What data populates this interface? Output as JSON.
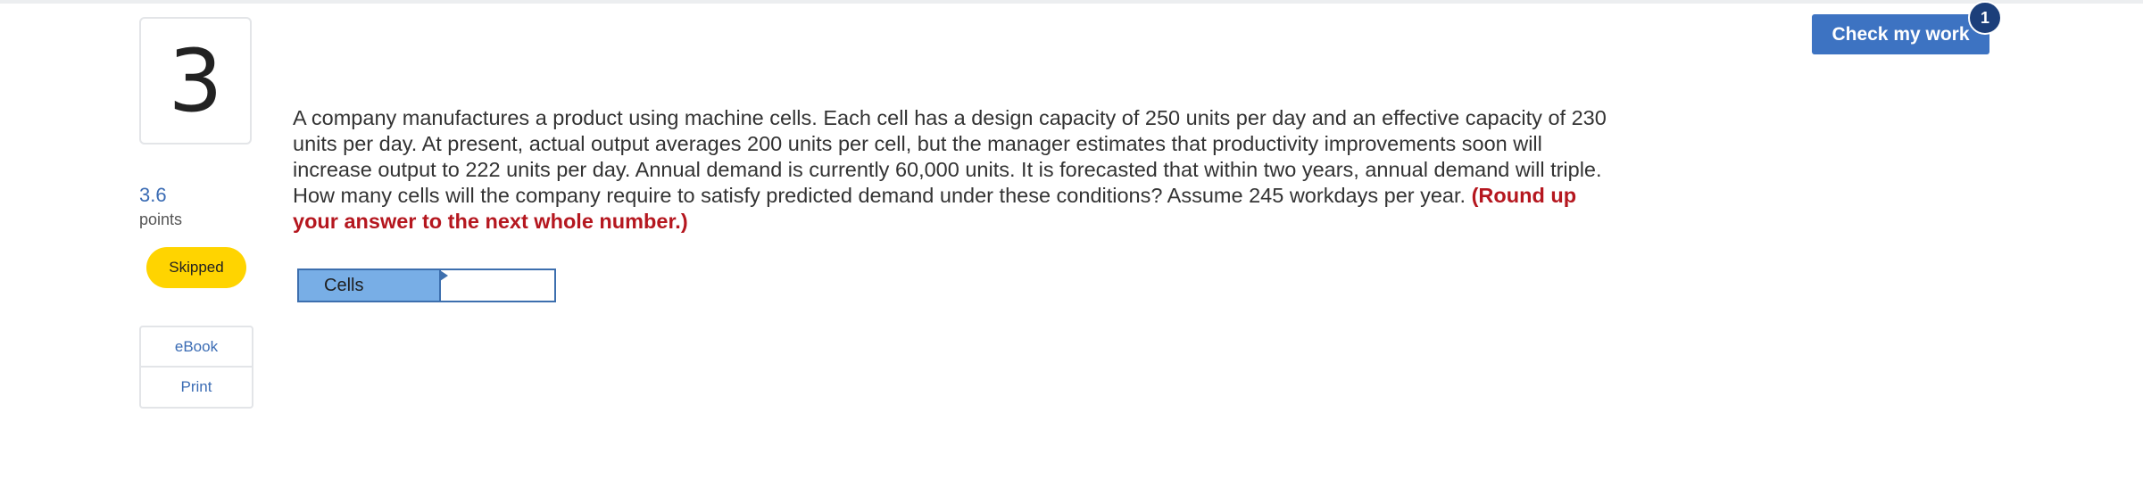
{
  "question": {
    "number": "3",
    "points_value": "3.6",
    "points_label": "points",
    "status": "Skipped",
    "text": "A company manufactures a product using machine cells. Each cell has a design capacity of 250 units per day and an effective capacity of 230 units per day. At present, actual output averages 200 units per cell, but the manager estimates that productivity improvements soon will increase output to 222 units per day. Annual demand is currently 60,000 units. It is forecasted that within two years, annual demand will triple. How many cells will the company require to satisfy predicted demand under these conditions? Assume 245 workdays per year.",
    "hint": "(Round up your answer to the next whole number.)"
  },
  "sidebar": {
    "ebook_label": "eBook",
    "print_label": "Print"
  },
  "answer": {
    "label": "Cells",
    "value": "",
    "placeholder": ""
  },
  "header": {
    "check_label": "Check my work",
    "check_count": "1"
  },
  "colors": {
    "accent": "#3d73c2",
    "badge": "#ffd400",
    "hint": "#b5171f",
    "answer_label_bg": "#78aee6"
  }
}
